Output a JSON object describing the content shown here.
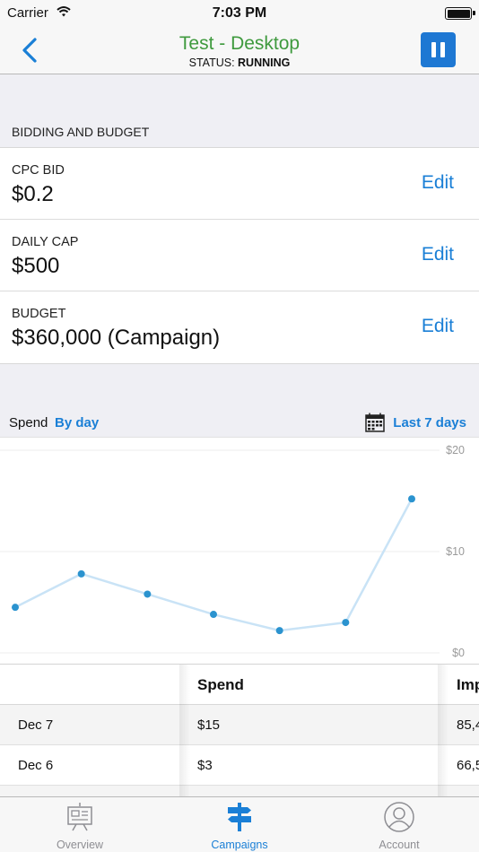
{
  "status_bar": {
    "carrier": "Carrier",
    "time": "7:03 PM"
  },
  "nav": {
    "title": "Test - Desktop",
    "status_prefix": "STATUS:",
    "status_value": "RUNNING"
  },
  "bidding": {
    "section_title": "BIDDING AND BUDGET",
    "rows": [
      {
        "label": "CPC BID",
        "value": "$0.2",
        "action": "Edit"
      },
      {
        "label": "DAILY CAP",
        "value": "$500",
        "action": "Edit"
      },
      {
        "label": "BUDGET",
        "value": "$360,000 (Campaign)",
        "action": "Edit"
      }
    ]
  },
  "spend": {
    "label": "Spend",
    "mode": "By day",
    "range": "Last 7 days"
  },
  "chart_data": {
    "type": "line",
    "y_tick_labels": [
      "$0",
      "$10",
      "$20"
    ],
    "ylim": [
      0,
      20
    ],
    "values": [
      4.5,
      7.8,
      5.8,
      3.8,
      2.2,
      3.0,
      15.2
    ],
    "grid": true,
    "colors": {
      "line": "#c9e3f6",
      "point": "#2b93cf"
    }
  },
  "table": {
    "headers": [
      "",
      "Spend",
      "Imp"
    ],
    "rows": [
      [
        "Dec 7",
        "$15",
        "85,4"
      ],
      [
        "Dec 6",
        "$3",
        "66,5"
      ],
      [
        "",
        "",
        ""
      ]
    ]
  },
  "tabs": [
    {
      "label": "Overview",
      "icon": "presentation-icon",
      "active": false
    },
    {
      "label": "Campaigns",
      "icon": "signpost-icon",
      "active": true
    },
    {
      "label": "Account",
      "icon": "person-icon",
      "active": false
    }
  ],
  "colors": {
    "accent": "#1a7fd6",
    "title_green": "#3f9a3e",
    "pause_button": "#1e78d3"
  }
}
